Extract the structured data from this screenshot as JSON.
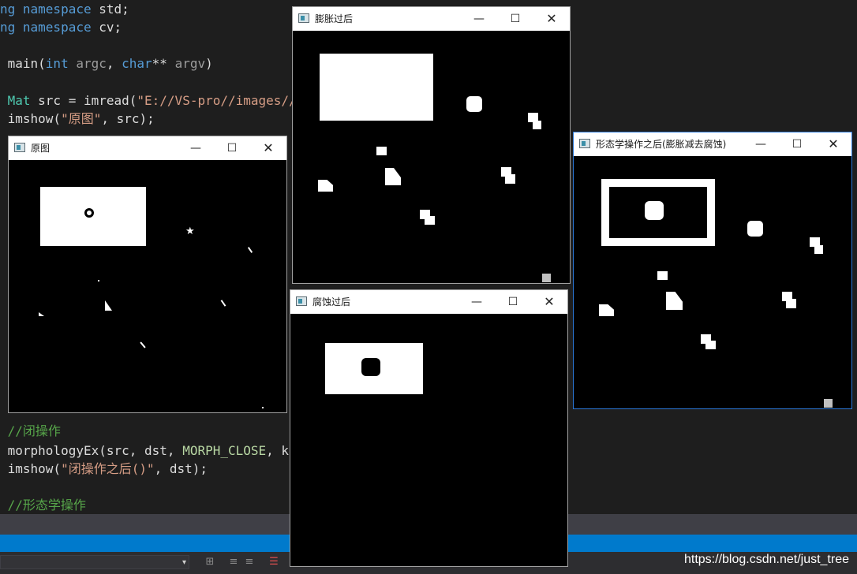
{
  "code": {
    "line1": {
      "kw": "ng namespace",
      "rest": " std;"
    },
    "line2": {
      "kw": "ng namespace",
      "rest": " cv;"
    },
    "line3": {
      "a": " main(",
      "t1": "int",
      "p1": " argc",
      "c": ", ",
      "t2": "char",
      "s": "** ",
      "p2": "argv",
      "e": ")"
    },
    "line4": {
      "ty": " Mat",
      "a": " src = imread(",
      "str": "\"E://VS-pro//images//l"
    },
    "line5": {
      "a": " imshow(",
      "str": "\"原图\"",
      "b": ", src);"
    },
    "line6": {
      "cm": " //闭操作"
    },
    "line7": {
      "a": " morphologyEx(src, dst, ",
      "mc": "MORPH_CLOSE",
      "b": ", ke"
    },
    "line8": {
      "a": " imshow(",
      "str": "\"闭操作之后()\"",
      "b": ", dst);"
    },
    "line9": {
      "cm": " //形态学操作"
    }
  },
  "windows": {
    "original": {
      "title": "原图"
    },
    "dilate": {
      "title": "膨胀过后"
    },
    "erode": {
      "title": "腐蚀过后"
    },
    "gradient": {
      "title": "形态学操作之后(膨胀减去腐蚀)"
    }
  },
  "controls": {
    "minimize": "—",
    "maximize": "☐",
    "close": "✕"
  },
  "statusbar": {
    "watermark": "https://blog.csdn.net/just_tree",
    "combo_arrow": "▾"
  },
  "icons": {
    "window": "app-window-icon",
    "toolbar": [
      "format-icon",
      "outdent-icon",
      "indent-icon",
      "bookmark-icon"
    ]
  },
  "colors": {
    "editor_bg": "#1e1e1e",
    "keyword": "#569cd6",
    "type": "#4ec9b0",
    "comment": "#57a64a",
    "string": "#d69d85",
    "accent": "#007acc"
  }
}
